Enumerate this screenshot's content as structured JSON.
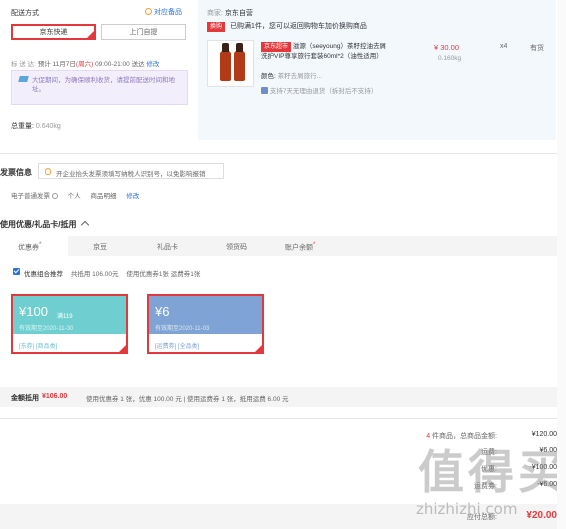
{
  "shipping": {
    "title": "配送方式",
    "compare_link": "对应备品",
    "options": [
      "京东快递",
      "上门自提"
    ],
    "standard_label": "标 送 达:",
    "delivery_time_pre": "预计 11月7日",
    "delivery_weekday": "(周六)",
    "delivery_time_post": "09:00-21:00 送达",
    "modify": "修改",
    "notice": "大促期间，为确保顺利收货，请提前配送时间和地址。",
    "weight_label": "总重量:",
    "weight_value": "0.640kg"
  },
  "seller": {
    "label": "商家:",
    "name": "京东自营",
    "promo_tag": "换购",
    "promo_text": "已购满1件，您可以返回购物车加价换购商品"
  },
  "product": {
    "badge": "京东超市",
    "name_line1": "滋源（seeyoung）茶籽控油去屑",
    "name_line2": "洗护VIP尊享旅行套装60ml*2（油性适用）",
    "price": "¥ 30.00",
    "qty": "x4",
    "stock": "有货",
    "weight": "0.160kg",
    "color_label": "颜色:",
    "color_value": "茶籽去屑旅行...",
    "return_note": "支持7天无理由退货（拆封后不支持）"
  },
  "invoice": {
    "title": "发票信息",
    "tip": "开企业抬头发票须填写纳税人识别号，以免影响报销",
    "type": "电子普通发票",
    "holder": "个人",
    "content": "商品明细",
    "edit": "修改"
  },
  "coupons": {
    "title": "使用优惠/礼品卡/抵用",
    "tabs": [
      "优惠券",
      "京豆",
      "礼品卡",
      "领货码",
      "账户余额"
    ],
    "opt_label": "优惠组合推荐",
    "opt_summary": "共抵用 106.00元",
    "opt_used": "使用优惠券1张 运费券1张",
    "cards": [
      {
        "amount": "¥100",
        "condition": "满119",
        "date": "有效期至2020-11-30",
        "limit": "[东券] [商品类]",
        "color": "#6fcfd0"
      },
      {
        "amount": "¥6",
        "condition": "",
        "date": "有效期至2020-11-03",
        "limit": "[运费券] [全品类]",
        "color": "#7ea3d4"
      }
    ]
  },
  "discount_summary": {
    "label": "金额抵用",
    "amount": "¥106.00",
    "detail": "使用优惠券 1 张，优惠 100.00 元 | 使用运费券 1 张，抵用运费 6.00 元"
  },
  "totals": {
    "count_prefix": "4",
    "count_label": "件商品，总商品金额:",
    "goods_total": "¥120.00",
    "rows": [
      {
        "label": "运费:",
        "value": "¥6.00"
      },
      {
        "label": "优惠:",
        "value": "-¥100.00"
      },
      {
        "label": "运费券:",
        "value": "-¥6.00"
      }
    ],
    "payable_label": "应付总额:",
    "payable_value": "¥20.00"
  },
  "watermark": {
    "chars": "值 得 买",
    "url": "zhizhizhi.com"
  },
  "colors": {
    "accent": "#e4393c",
    "coupon_cyan": "#6fcfd0",
    "coupon_blue": "#7ea3d4"
  }
}
